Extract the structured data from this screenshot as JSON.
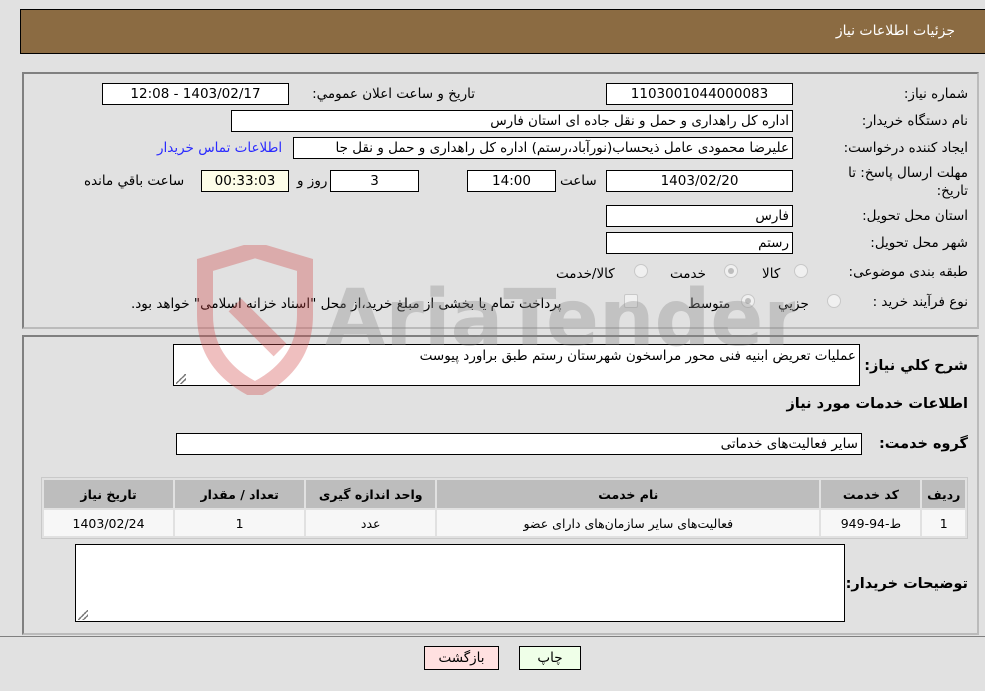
{
  "header": {
    "title": "جزئیات اطلاعات نیاز"
  },
  "form": {
    "need_number": {
      "label": "شماره نیاز:",
      "value": "1103001044000083"
    },
    "announce_datetime": {
      "label": "تاریخ و ساعت اعلان عمومي:",
      "value": "1403/02/17 - 12:08"
    },
    "buyer_org": {
      "label": "نام دستگاه خريدار:",
      "value": "اداره کل راهداری و حمل و نقل جاده ای استان فارس"
    },
    "requester": {
      "label": "ايجاد کننده درخواست:",
      "value": "علیرضا محمودی عامل ذیحساب(نورآباد،رستم) اداره کل راهداری و حمل و نقل جا"
    },
    "buyer_contact_link": "اطلاعات تماس خريدار",
    "deadline": {
      "label": "مهلت ارسال پاسخ: تا تاریخ:",
      "date": "1403/02/20",
      "time_label": "ساعت",
      "time": "14:00",
      "days": "3",
      "days_label": "روز و",
      "remaining": "00:33:03",
      "remaining_label": "ساعت باقي مانده"
    },
    "delivery_province": {
      "label": "استان محل تحويل:",
      "value": "فارس"
    },
    "delivery_city": {
      "label": "شهر محل تحويل:",
      "value": "رستم"
    },
    "category": {
      "label": "طبقه بندی موضوعی:",
      "options": [
        "کالا",
        "خدمت",
        "کالا/خدمت"
      ],
      "selected": "خدمت"
    },
    "purchase_process": {
      "label": "نوع فرآيند خريد :",
      "options": [
        "جزيي",
        "متوسط"
      ],
      "selected": "متوسط",
      "treasury_note": "پرداخت تمام یا بخشی از مبلغ خرید،از محل \"اسناد خزانه اسلامی\" خواهد بود."
    }
  },
  "details": {
    "description_label": "شرح کلي نياز:",
    "description": "عملیات تعریض ابنیه فنی محور مراسخون شهرستان رستم طبق براورد پیوست",
    "services_heading": "اطلاعات خدمات مورد نياز",
    "service_group_label": "گروه خدمت:",
    "service_group": "سایر فعالیت‌های خدماتی",
    "table": {
      "headers": [
        "رديف",
        "کد خدمت",
        "نام خدمت",
        "واحد اندازه گيری",
        "تعداد / مقدار",
        "تاريخ نياز"
      ],
      "rows": [
        [
          "1",
          "ط-94-949",
          "فعالیت‌های سایر سازمان‌های دارای عضو",
          "عدد",
          "1",
          "1403/02/24"
        ]
      ]
    },
    "buyer_notes_label": "توضيحات خريدار:",
    "buyer_notes": ""
  },
  "buttons": {
    "print": "چاپ",
    "back": "بازگشت"
  },
  "watermark": "AriaTender.neT"
}
